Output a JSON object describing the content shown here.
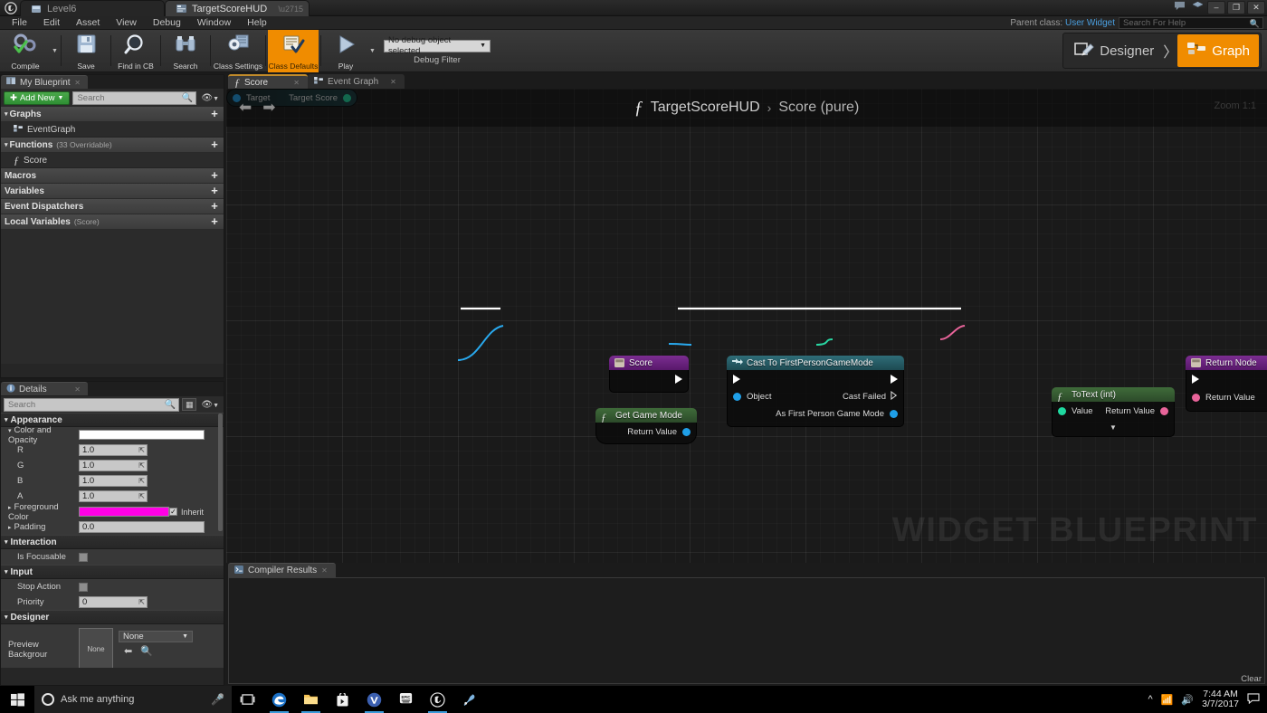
{
  "window": {
    "tabs": [
      {
        "label": "Level6",
        "icon": "level-icon",
        "active": false
      },
      {
        "label": "TargetScoreHUD",
        "icon": "widget-blueprint-icon",
        "active": true
      }
    ],
    "controls": {
      "minimize": "–",
      "maximize": "❐",
      "close": "✕"
    }
  },
  "menu": {
    "items": [
      "File",
      "Edit",
      "Asset",
      "View",
      "Debug",
      "Window",
      "Help"
    ],
    "parent_class_label": "Parent class:",
    "parent_class_value": "User Widget",
    "help_search_placeholder": "Search For Help"
  },
  "toolbar": {
    "buttons": [
      {
        "label": "Compile",
        "name": "compile-button",
        "dropdown": true
      },
      {
        "label": "Save",
        "name": "save-button"
      },
      {
        "label": "Find in CB",
        "name": "find-in-cb-button"
      },
      {
        "label": "Search",
        "name": "search-button"
      },
      {
        "label": "Class Settings",
        "name": "class-settings-button"
      },
      {
        "label": "Class Defaults",
        "name": "class-defaults-button",
        "active": true
      },
      {
        "label": "Play",
        "name": "play-button",
        "dropdown": true
      }
    ],
    "debug_object_value": "No debug object selected",
    "debug_filter_label": "Debug Filter"
  },
  "mode_switcher": {
    "designer_label": "Designer",
    "graph_label": "Graph",
    "separator": "〉",
    "active": "Graph"
  },
  "my_blueprint": {
    "tab_label": "My Blueprint",
    "add_new_label": "Add New",
    "search_placeholder": "Search",
    "sections": [
      {
        "label": "Graphs",
        "sub": "",
        "expanded": true,
        "items": [
          {
            "label": "EventGraph",
            "icon": "event-graph-icon"
          }
        ]
      },
      {
        "label": "Functions",
        "sub": "(33 Overridable)",
        "expanded": true,
        "items": [
          {
            "label": "Score",
            "icon": "function-icon"
          }
        ]
      },
      {
        "label": "Macros",
        "sub": "",
        "expanded": false,
        "items": []
      },
      {
        "label": "Variables",
        "sub": "",
        "expanded": false,
        "items": []
      },
      {
        "label": "Event Dispatchers",
        "sub": "",
        "expanded": false,
        "items": []
      },
      {
        "label": "Local Variables",
        "sub": "(Score)",
        "expanded": false,
        "items": []
      }
    ]
  },
  "details": {
    "tab_label": "Details",
    "search_placeholder": "Search",
    "categories": [
      {
        "label": "Appearance",
        "rows": [
          {
            "label": "Color and Opacity",
            "type": "color",
            "value": "#ffffff",
            "expandable": true,
            "indent": false
          },
          {
            "label": "R",
            "type": "number",
            "value": "1.0",
            "indent": true
          },
          {
            "label": "G",
            "type": "number",
            "value": "1.0",
            "indent": true
          },
          {
            "label": "B",
            "type": "number",
            "value": "1.0",
            "indent": true
          },
          {
            "label": "A",
            "type": "number",
            "value": "1.0",
            "indent": true
          },
          {
            "label": "Foreground Color",
            "type": "color-inherit",
            "value": "#ff00e5",
            "inherit_label": "Inherit",
            "inherit_checked": true,
            "expandable": true
          },
          {
            "label": "Padding",
            "type": "text",
            "value": "0.0",
            "expandable": true
          }
        ]
      },
      {
        "label": "Interaction",
        "rows": [
          {
            "label": "Is Focusable",
            "type": "checkbox",
            "checked": false
          }
        ]
      },
      {
        "label": "Input",
        "rows": [
          {
            "label": "Stop Action",
            "type": "checkbox",
            "checked": false
          },
          {
            "label": "Priority",
            "type": "number",
            "value": "0"
          }
        ]
      },
      {
        "label": "Designer",
        "rows": [
          {
            "label": "Preview Backgrour",
            "type": "asset",
            "thumb_label": "None",
            "value": "None"
          }
        ]
      }
    ]
  },
  "graph": {
    "tabs": [
      {
        "label": "Score",
        "icon": "function-icon",
        "active": true
      },
      {
        "label": "Event Graph",
        "icon": "event-graph-icon",
        "active": false
      }
    ],
    "breadcrumb_root": "TargetScoreHUD",
    "breadcrumb_sep": "›",
    "breadcrumb_current": "Score (pure)",
    "zoom_label": "Zoom 1:1",
    "watermark": "WIDGET BLUEPRINT",
    "nodes": [
      {
        "name": "score-entry-node",
        "title": "Score",
        "icon": "node-entry-icon",
        "header_color": "#7b2d91",
        "pins": [
          {
            "label": "",
            "type": "exec-out"
          }
        ]
      },
      {
        "name": "cast-to-first-person-game-mode-node",
        "title": "Cast To FirstPersonGameMode",
        "icon": "cast-icon",
        "header_color": "#2f6d78",
        "pins": [
          {
            "label": "",
            "type": "exec-in"
          },
          {
            "label": "",
            "type": "exec-out"
          },
          {
            "label": "Object",
            "type": "object-in",
            "color": "#1f9fe8"
          },
          {
            "label": "Cast Failed",
            "type": "exec-out-hollow"
          },
          {
            "label": "As First Person Game Mode",
            "type": "object-out",
            "color": "#1f9fe8"
          }
        ]
      },
      {
        "name": "get-game-mode-node",
        "title": "Get Game Mode",
        "icon": "function-icon",
        "header_color": "#3f6b3a",
        "pins": [
          {
            "label": "Return Value",
            "type": "object-out",
            "color": "#1f9fe8"
          }
        ]
      },
      {
        "name": "target-score-getter-node",
        "title": "",
        "header_color": "#1a3e42",
        "pins": [
          {
            "label": "Target",
            "type": "object-in",
            "color": "#1f9fe8"
          },
          {
            "label": "Target Score",
            "type": "int-out",
            "color": "#1fd9a0"
          }
        ]
      },
      {
        "name": "to-text-int-node",
        "title": "ToText (int)",
        "icon": "function-icon",
        "header_color": "#3f6b3a",
        "pins": [
          {
            "label": "Value",
            "type": "int-in",
            "color": "#1fd9a0"
          },
          {
            "label": "Return Value",
            "type": "text-out",
            "color": "#e8649a"
          }
        ],
        "expander": "▼"
      },
      {
        "name": "return-node",
        "title": "Return Node",
        "icon": "node-entry-icon",
        "header_color": "#7b2d91",
        "pins": [
          {
            "label": "",
            "type": "exec-in"
          },
          {
            "label": "Return Value",
            "type": "text-in",
            "color": "#e8649a"
          }
        ]
      }
    ]
  },
  "compiler": {
    "tab_label": "Compiler Results",
    "clear_label": "Clear",
    "messages": []
  },
  "taskbar": {
    "search_placeholder": "Ask me anything",
    "apps": [
      {
        "name": "task-view-icon",
        "glyph": "❑"
      },
      {
        "name": "edge-icon",
        "glyph": "e"
      },
      {
        "name": "file-explorer-icon",
        "glyph": "▬"
      },
      {
        "name": "store-icon",
        "glyph": "▤"
      },
      {
        "name": "visual-paradigm-icon",
        "glyph": "Ⓥ"
      },
      {
        "name": "epic-games-launcher-icon",
        "glyph": "EPIC"
      },
      {
        "name": "unreal-editor-icon",
        "glyph": "ⓤ"
      },
      {
        "name": "paint-net-icon",
        "glyph": "✐"
      }
    ],
    "time": "7:44 AM",
    "date": "3/7/2017"
  },
  "colors": {
    "accent_orange": "#f08c00",
    "exec_white": "#ffffff",
    "object_blue": "#1f9fe8",
    "int_green": "#1fd9a0",
    "text_pink": "#e8649a",
    "node_purple": "#7b2d91",
    "node_teal": "#2f6d78",
    "node_green": "#3f6b3a"
  }
}
